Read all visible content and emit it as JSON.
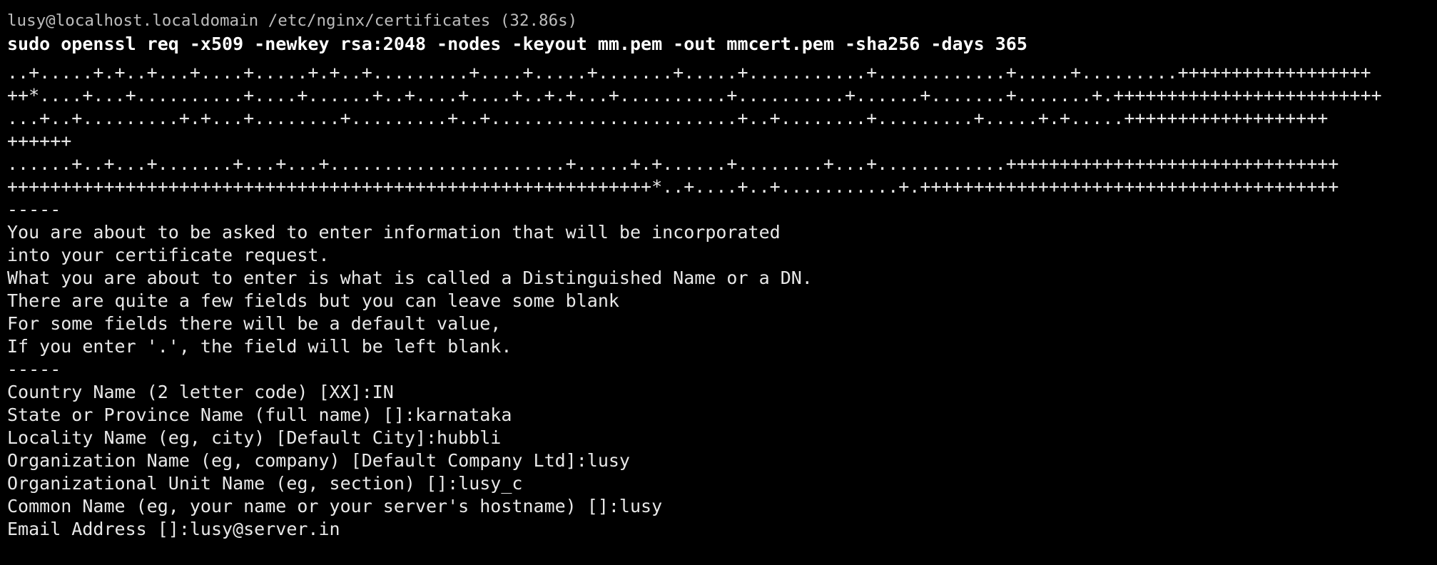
{
  "terminal": {
    "prompt": "lusy@localhost.localdomain /etc/nginx/certificates (32.86s)",
    "command": "sudo openssl req -x509 -newkey rsa:2048 -nodes -keyout mm.pem -out mmcert.pem -sha256 -days 365",
    "output": [
      "..+.....+.+..+...+....+.....+.+..+.........+....+.....+.......+.....+...........+............+.....+.........++++++++++++++++++",
      "++*....+...+..........+....+......+..+....+....+..+.+...+..........+..........+......+.......+.......+.+++++++++++++++++++++++++",
      "...+..+.........+.+...+........+.........+..+.......................+..+........+.........+.....+.+.....+++++++++++++++++++",
      "++++++",
      "......+..+...+.......+...+...+......................+.....+.+......+........+...+............+++++++++++++++++++++++++++++++",
      "++++++++++++++++++++++++++++++++++++++++++++++++++++++++++++*..+....+..+...........+.+++++++++++++++++++++++++++++++++++++++",
      "-----",
      "You are about to be asked to enter information that will be incorporated",
      "into your certificate request.",
      "What you are about to enter is what is called a Distinguished Name or a DN.",
      "There are quite a few fields but you can leave some blank",
      "For some fields there will be a default value,",
      "If you enter '.', the field will be left blank.",
      "-----",
      "Country Name (2 letter code) [XX]:IN",
      "State or Province Name (full name) []:karnataka",
      "Locality Name (eg, city) [Default City]:hubbli",
      "Organization Name (eg, company) [Default Company Ltd]:lusy",
      "Organizational Unit Name (eg, section) []:lusy_c",
      "Common Name (eg, your name or your server's hostname) []:lusy",
      "Email Address []:lusy@server.in"
    ]
  }
}
